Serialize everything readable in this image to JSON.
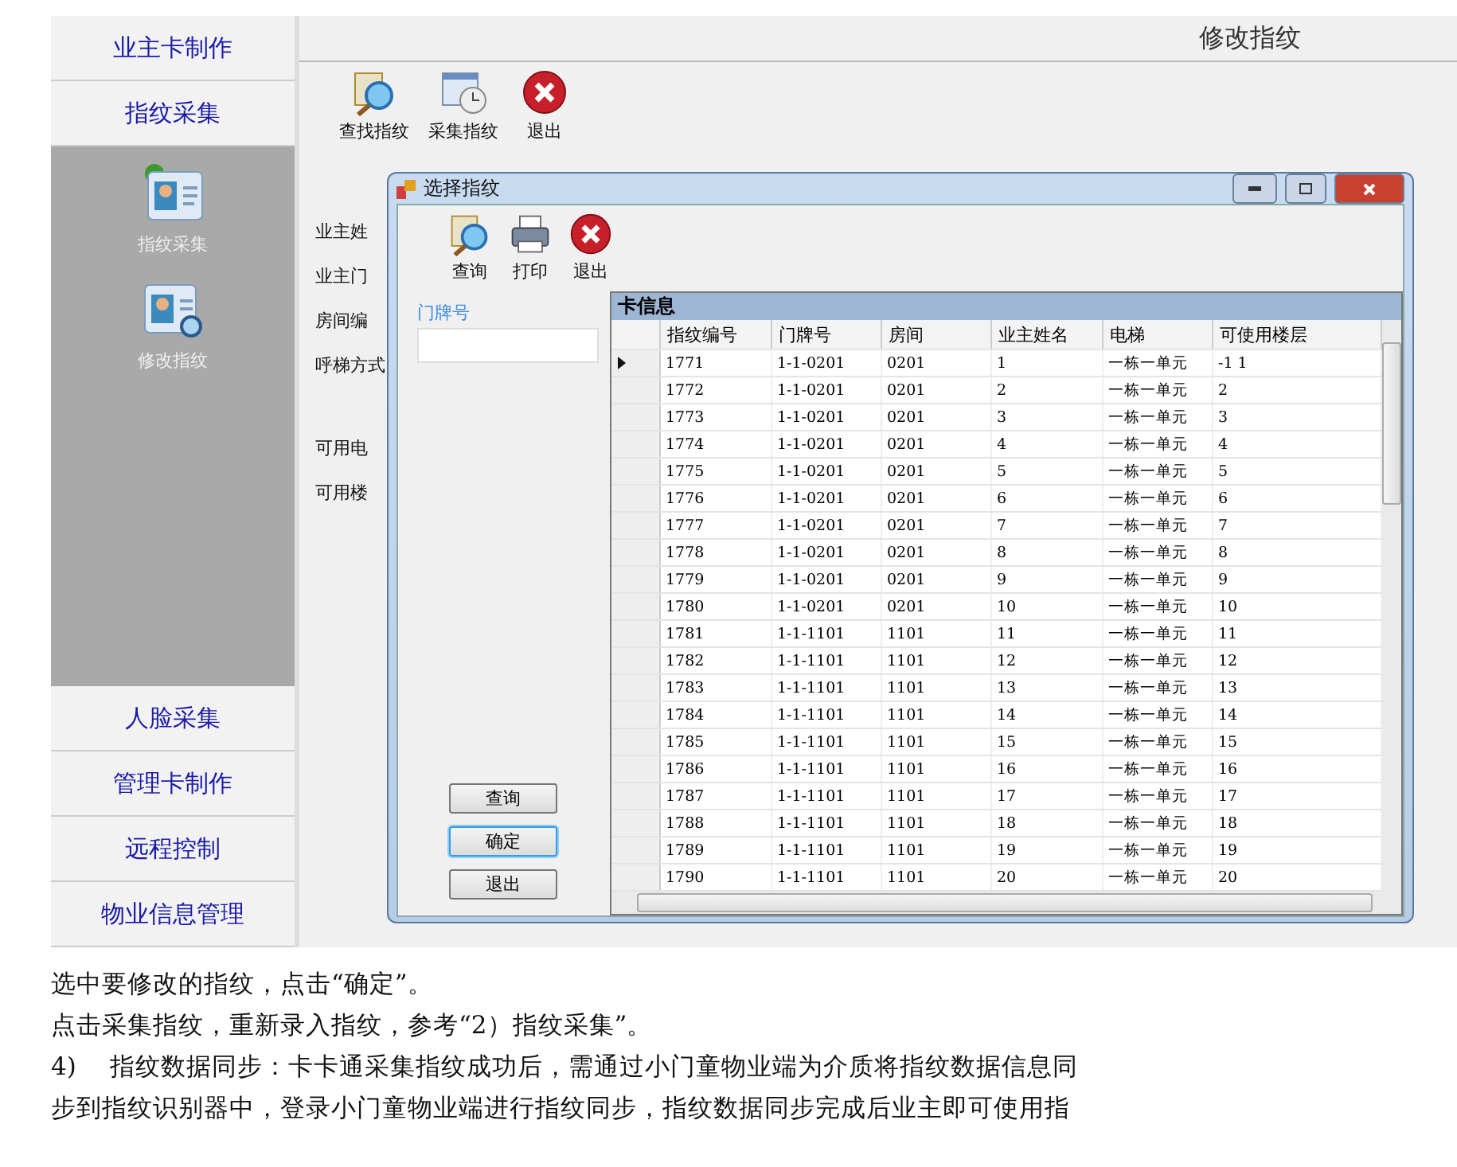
{
  "sidebar": {
    "top_items": [
      {
        "label": "业主卡制作"
      },
      {
        "label": "指纹采集"
      }
    ],
    "sub_items": [
      {
        "label": "指纹采集",
        "kind": "collect"
      },
      {
        "label": "修改指纹",
        "kind": "edit"
      }
    ],
    "bottom_items": [
      {
        "label": "人脸采集"
      },
      {
        "label": "管理卡制作"
      },
      {
        "label": "远程控制"
      },
      {
        "label": "物业信息管理"
      }
    ]
  },
  "main": {
    "title": "修改指纹",
    "toolbar": [
      {
        "label": "查找指纹",
        "kind": "search"
      },
      {
        "label": "采集指纹",
        "kind": "calendar"
      },
      {
        "label": "退出",
        "kind": "exit"
      }
    ],
    "form_labels": [
      "业主姓",
      "业主门",
      "房间编",
      "呼梯方式",
      "可用电",
      "可用楼"
    ]
  },
  "dialog": {
    "title": "选择指纹",
    "toolbar": [
      {
        "label": "查询",
        "kind": "search"
      },
      {
        "label": "打印",
        "kind": "print"
      },
      {
        "label": "退出",
        "kind": "exit"
      }
    ],
    "filter_label": "门牌号",
    "buttons": [
      {
        "label": "查询",
        "focused": false
      },
      {
        "label": "确定",
        "focused": true
      },
      {
        "label": "退出",
        "focused": false
      }
    ],
    "grid": {
      "title": "卡信息",
      "columns": [
        "指纹编号",
        "门牌号",
        "房间",
        "业主姓名",
        "电梯",
        "可使用楼层"
      ],
      "rows": [
        {
          "current": true,
          "cells": [
            "1771",
            "1-1-0201",
            "0201",
            "1",
            "一栋一单元",
            "-1 1"
          ]
        },
        {
          "current": false,
          "cells": [
            "1772",
            "1-1-0201",
            "0201",
            "2",
            "一栋一单元",
            "2"
          ]
        },
        {
          "current": false,
          "cells": [
            "1773",
            "1-1-0201",
            "0201",
            "3",
            "一栋一单元",
            "3"
          ]
        },
        {
          "current": false,
          "cells": [
            "1774",
            "1-1-0201",
            "0201",
            "4",
            "一栋一单元",
            "4"
          ]
        },
        {
          "current": false,
          "cells": [
            "1775",
            "1-1-0201",
            "0201",
            "5",
            "一栋一单元",
            "5"
          ]
        },
        {
          "current": false,
          "cells": [
            "1776",
            "1-1-0201",
            "0201",
            "6",
            "一栋一单元",
            "6"
          ]
        },
        {
          "current": false,
          "cells": [
            "1777",
            "1-1-0201",
            "0201",
            "7",
            "一栋一单元",
            "7"
          ]
        },
        {
          "current": false,
          "cells": [
            "1778",
            "1-1-0201",
            "0201",
            "8",
            "一栋一单元",
            "8"
          ]
        },
        {
          "current": false,
          "cells": [
            "1779",
            "1-1-0201",
            "0201",
            "9",
            "一栋一单元",
            "9"
          ]
        },
        {
          "current": false,
          "cells": [
            "1780",
            "1-1-0201",
            "0201",
            "10",
            "一栋一单元",
            "10"
          ]
        },
        {
          "current": false,
          "cells": [
            "1781",
            "1-1-1101",
            "1101",
            "11",
            "一栋一单元",
            "11"
          ]
        },
        {
          "current": false,
          "cells": [
            "1782",
            "1-1-1101",
            "1101",
            "12",
            "一栋一单元",
            "12"
          ]
        },
        {
          "current": false,
          "cells": [
            "1783",
            "1-1-1101",
            "1101",
            "13",
            "一栋一单元",
            "13"
          ]
        },
        {
          "current": false,
          "cells": [
            "1784",
            "1-1-1101",
            "1101",
            "14",
            "一栋一单元",
            "14"
          ]
        },
        {
          "current": false,
          "cells": [
            "1785",
            "1-1-1101",
            "1101",
            "15",
            "一栋一单元",
            "15"
          ]
        },
        {
          "current": false,
          "cells": [
            "1786",
            "1-1-1101",
            "1101",
            "16",
            "一栋一单元",
            "16"
          ]
        },
        {
          "current": false,
          "cells": [
            "1787",
            "1-1-1101",
            "1101",
            "17",
            "一栋一单元",
            "17"
          ]
        },
        {
          "current": false,
          "cells": [
            "1788",
            "1-1-1101",
            "1101",
            "18",
            "一栋一单元",
            "18"
          ]
        },
        {
          "current": false,
          "cells": [
            "1789",
            "1-1-1101",
            "1101",
            "19",
            "一栋一单元",
            "19"
          ]
        },
        {
          "current": false,
          "cells": [
            "1790",
            "1-1-1101",
            "1101",
            "20",
            "一栋一单元",
            "20"
          ]
        }
      ]
    }
  },
  "document": {
    "lines": [
      "选中要修改的指纹，点击“确定”。",
      "点击采集指纹，重新录入指纹，参考“2）指纹采集”。",
      "4)　 指纹数据同步：卡卡通采集指纹成功后，需通过小门童物业端为介质将指纹数据信息同",
      "步到指纹识别器中，登录小门童物业端进行指纹同步，指纹数据同步完成后业主即可使用指"
    ]
  }
}
